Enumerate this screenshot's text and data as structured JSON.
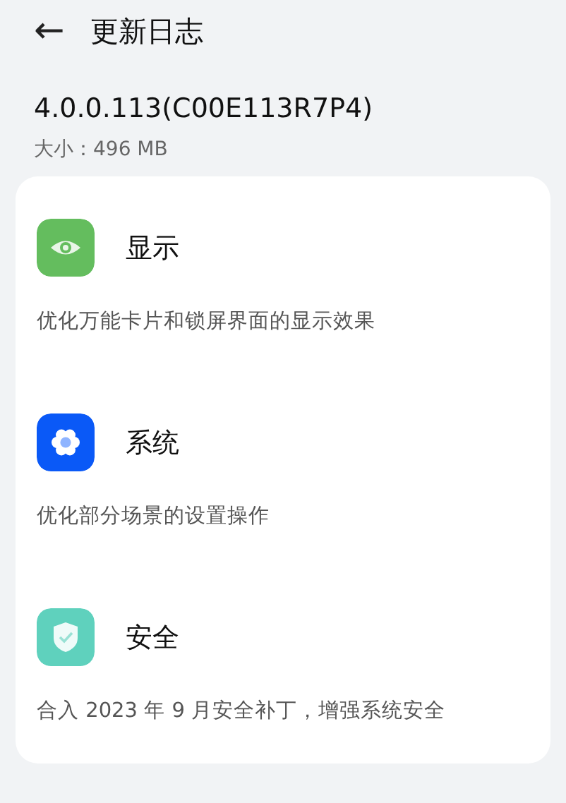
{
  "header": {
    "back_icon": "←",
    "title": "更新日志"
  },
  "version": "4.0.0.113(C00E113R7P4)",
  "size": "大小：496 MB",
  "sections": [
    {
      "kind": "eye",
      "color": "#64bd5e",
      "title": "显示",
      "description": "优化万能卡片和锁屏界面的显示效果"
    },
    {
      "kind": "gear",
      "color": "#0a59f7",
      "title": "系统",
      "description": "优化部分场景的设置操作"
    },
    {
      "kind": "shield",
      "color": "#5fd1bd",
      "title": "安全",
      "description": "合入 2023 年 9 月安全补丁，增强系统安全"
    }
  ]
}
